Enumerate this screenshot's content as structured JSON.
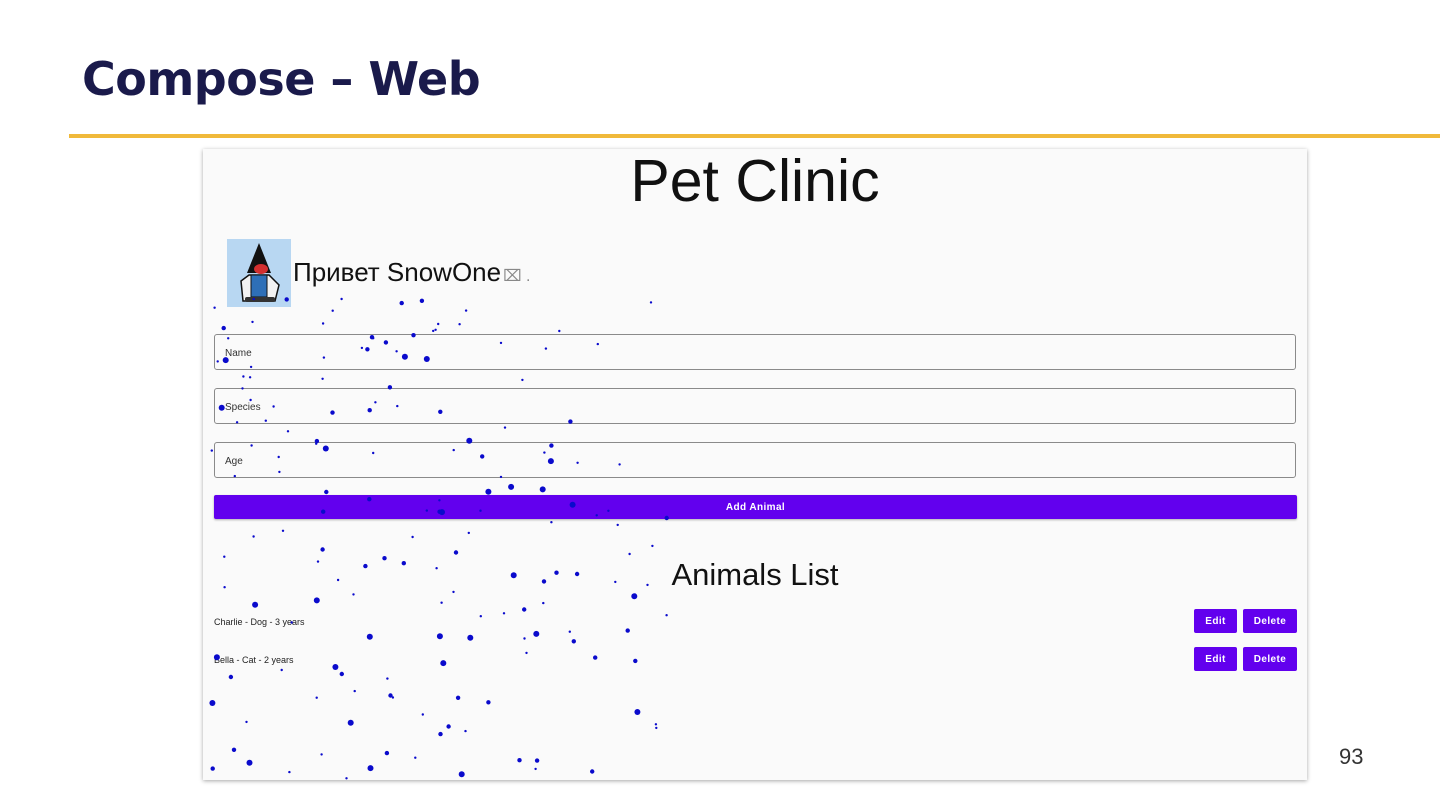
{
  "slide": {
    "title": "Compose – Web",
    "page_number": "93"
  },
  "app": {
    "title": "Pet Clinic",
    "greeting": "Привет SnowOne",
    "greeting_tail": "⌧ .",
    "avatar_icon": "duke-snowboard-icon",
    "form": {
      "name_label": "Name",
      "species_label": "Species",
      "age_label": "Age",
      "add_button": "Add Animal"
    },
    "list": {
      "title": "Animals List",
      "items": [
        {
          "text": "Charlie - Dog - 3 years",
          "edit": "Edit",
          "delete": "Delete"
        },
        {
          "text": "Bella - Cat - 2 years",
          "edit": "Edit",
          "delete": "Delete"
        }
      ]
    }
  },
  "colors": {
    "accent_purple": "#6200ee",
    "title_navy": "#1a1a4b",
    "rule_gold": "#f0b93a",
    "snow_blue": "#0a0acc"
  }
}
